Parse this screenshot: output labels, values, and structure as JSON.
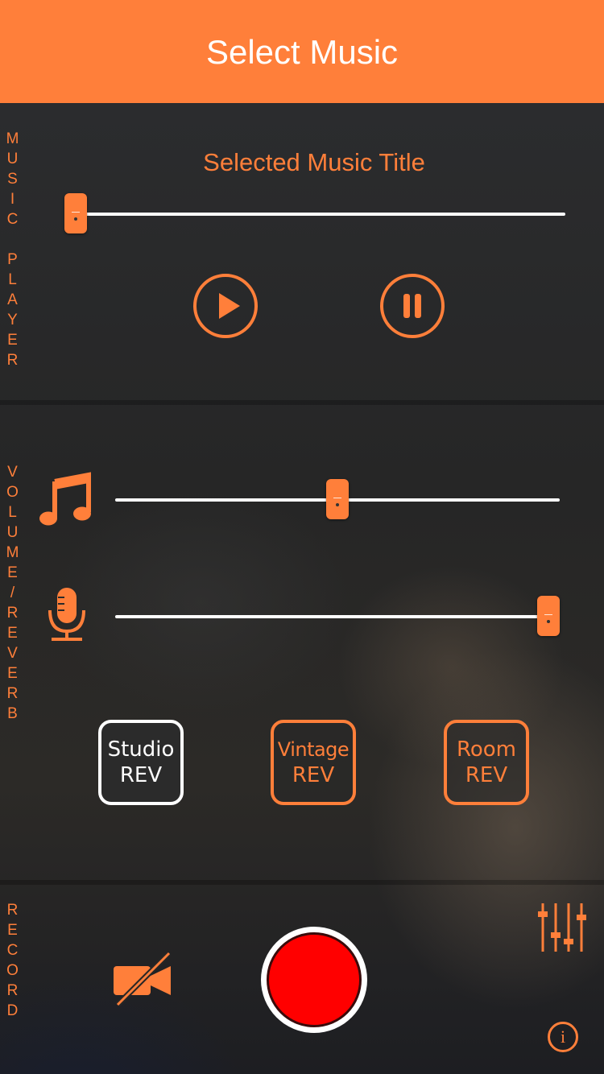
{
  "header": {
    "title": "Select Music"
  },
  "sections": {
    "music_player_label": "MUSIC PLAYER",
    "volume_reverb_label": "VOLUME/REVERB",
    "record_label": "RECORD"
  },
  "player": {
    "track_title": "Selected Music Title",
    "progress_fraction": 0.0,
    "play_icon": "play-icon",
    "pause_icon": "pause-icon"
  },
  "volume": {
    "music_icon": "music-note-icon",
    "mic_icon": "microphone-icon",
    "music_level_fraction": 0.5,
    "mic_level_fraction": 1.0
  },
  "reverb": {
    "buttons": [
      {
        "line1": "Studio",
        "line2": "REV",
        "selected": true
      },
      {
        "line1": "Vintage",
        "line2": "REV",
        "selected": false
      },
      {
        "line1": "Room",
        "line2": "REV",
        "selected": false
      }
    ]
  },
  "record": {
    "camera_icon": "camera-off-icon",
    "mixer_icon": "mixer-sliders-icon",
    "info_icon": "info-icon",
    "info_glyph": "i"
  },
  "colors": {
    "accent": "#ff7f3a",
    "record": "#ff0000",
    "white": "#ffffff"
  }
}
